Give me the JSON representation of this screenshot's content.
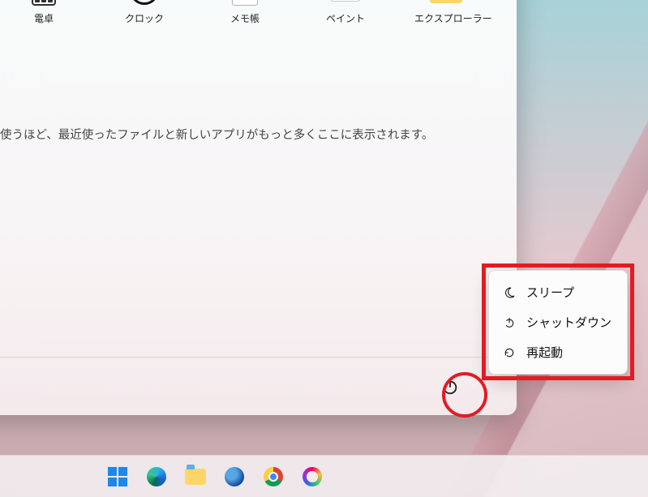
{
  "apps": [
    {
      "label": "電卓"
    },
    {
      "label": "クロック"
    },
    {
      "label": "メモ帳"
    },
    {
      "label": "ペイント"
    },
    {
      "label": "エクスプローラー"
    }
  ],
  "recent_hint": "使うほど、最近使ったファイルと新しいアプリがもっと多くここに表示されます。",
  "power_menu": {
    "sleep": "スリープ",
    "shutdown": "シャットダウン",
    "restart": "再起動"
  },
  "taskbar": [
    "start",
    "edge",
    "explorer",
    "thunderbird",
    "chrome",
    "paint"
  ]
}
